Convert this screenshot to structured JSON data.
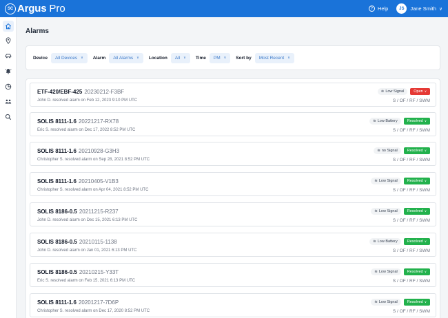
{
  "brand": {
    "seal": "SC",
    "name": "Argus",
    "product": "Pro"
  },
  "header": {
    "help": "Help",
    "help_icon": "?",
    "user_initials": "JS",
    "user_name": "Jane Smith",
    "user_chevron": "∨"
  },
  "nav": {
    "items": [
      {
        "name": "home-icon",
        "active": true
      },
      {
        "name": "location-icon",
        "active": false
      },
      {
        "name": "vehicle-icon",
        "active": false
      },
      {
        "name": "alarm-bell-icon",
        "active": false
      },
      {
        "name": "analytics-icon",
        "active": false
      },
      {
        "name": "users-icon",
        "active": false
      },
      {
        "name": "search-icon",
        "active": false
      }
    ]
  },
  "page": {
    "title": "Alarms"
  },
  "filters": {
    "device_label": "Device",
    "device_value": "All Devices",
    "alarm_label": "Alarm",
    "alarm_value": "All Alarms",
    "location_label": "Location",
    "location_value": "All",
    "time_label": "Time",
    "time_value": "PM",
    "sort_label": "Sort by",
    "sort_value": "Most Recent",
    "chevron": "∨"
  },
  "alarms": [
    {
      "device": "ETF-420/EBF-425",
      "alarm_id": "20230212-F3BF",
      "resolution": "John D. resolved alarm on Feb 12, 2023 9:10 PM UTC",
      "signal": "Low Signal",
      "status": "Open",
      "codes": "S / OF / RF / SWM"
    },
    {
      "device": "SOLIS 8111-1.6",
      "alarm_id": "20221217-RX78",
      "resolution": "Eric S. resolved alarm on Dec 17, 2022 8:52 PM UTC",
      "signal": "Low Battery",
      "status": "Resolved",
      "codes": "S / OF / RF / SWM"
    },
    {
      "device": "SOLIS 8111-1.6",
      "alarm_id": "20210928-G3H3",
      "resolution": "Christopher S. resolved alarm on Sep 28, 2021 8:52 PM UTC",
      "signal": "no Signal",
      "status": "Resolved",
      "codes": "S / OF / RF / SWM"
    },
    {
      "device": "SOLIS 8111-1.6",
      "alarm_id": "20210405-V1B3",
      "resolution": "Christopher S. resolved alarm on Apr 04, 2021 8:52 PM UTC",
      "signal": "Low Signal",
      "status": "Resolved",
      "codes": "S / OF / RF / SWM"
    },
    {
      "device": "SOLIS 8186-0.5",
      "alarm_id": "20211215-R237",
      "resolution": "John D. resolved alarm on Dec 15, 2021 6:13 PM UTC",
      "signal": "Low Signal",
      "status": "Resolved",
      "codes": "S / OF / RF / SWM"
    },
    {
      "device": "SOLIS 8186-0.5",
      "alarm_id": "20210115-1138",
      "resolution": "John D. resolved alarm on Jan 01, 2021 6:13 PM UTC",
      "signal": "Low Battery",
      "status": "Resolved",
      "codes": "S / OF / RF / SWM"
    },
    {
      "device": "SOLIS 8186-0.5",
      "alarm_id": "20210215-Y33T",
      "resolution": "Eric S. resolved alarm on Feb 15, 2021 6:13 PM UTC",
      "signal": "Low Signal",
      "status": "Resolved",
      "codes": "S / OF / RF / SWM"
    },
    {
      "device": "SOLIS 8111-1.6",
      "alarm_id": "20201217-7D6P",
      "resolution": "Christopher S. resolved alarm on Dec 17, 2020 8:52 PM UTC",
      "signal": "Low Signal",
      "status": "Resolved",
      "codes": "S / OF / RF / SWM"
    }
  ],
  "colors": {
    "brand": "#1a73d9",
    "open": "#e53935",
    "resolved": "#22b14c"
  }
}
